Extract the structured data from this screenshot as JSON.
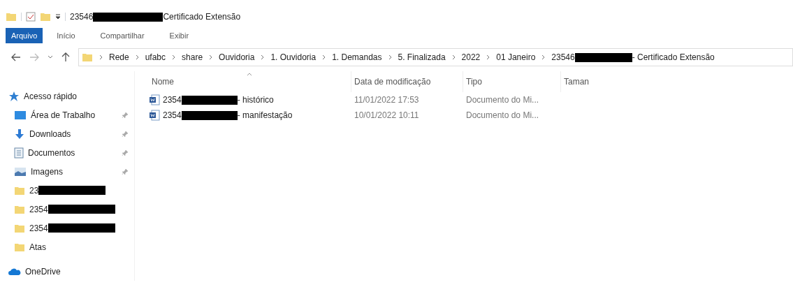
{
  "window": {
    "title": {
      "start": "23546",
      "redacted": true,
      "end": "Certificado Extensão"
    }
  },
  "ribbon_tabs": [
    {
      "label": "Arquivo",
      "selected": true
    },
    {
      "label": "Início",
      "selected": false
    },
    {
      "label": "Compartilhar",
      "selected": false
    },
    {
      "label": "Exibir",
      "selected": false
    }
  ],
  "address_bar": {
    "crumbs": [
      {
        "start": "Rede",
        "redacted": false
      },
      {
        "start": "ufabc",
        "redacted": false
      },
      {
        "start": "share",
        "redacted": false
      },
      {
        "start": "Ouvidoria",
        "redacted": false
      },
      {
        "start": "1. Ouvidoria",
        "redacted": false
      },
      {
        "start": "1. Demandas",
        "redacted": false
      },
      {
        "start": "5. Finalizada",
        "redacted": false
      },
      {
        "start": "2022",
        "redacted": false
      },
      {
        "start": "01 Janeiro",
        "redacted": false
      },
      {
        "start": "23546",
        "redacted": true,
        "end": "- Certificado Extensão"
      }
    ]
  },
  "sidebar": {
    "items": [
      {
        "kind": "quick",
        "label": "Acesso rápido",
        "pinned": false,
        "redacted": false
      },
      {
        "kind": "desktop",
        "label": "Área de Trabalho",
        "pinned": true,
        "redacted": false
      },
      {
        "kind": "downloads",
        "label": "Downloads",
        "pinned": true,
        "redacted": false
      },
      {
        "kind": "documents",
        "label": "Documentos",
        "pinned": true,
        "redacted": false
      },
      {
        "kind": "images",
        "label": "Imagens",
        "pinned": true,
        "redacted": false
      },
      {
        "kind": "folder",
        "label": "23",
        "pinned": false,
        "redacted": true
      },
      {
        "kind": "folder",
        "label": "2354",
        "pinned": false,
        "redacted": true
      },
      {
        "kind": "folder",
        "label": "2354",
        "pinned": false,
        "redacted": true
      },
      {
        "kind": "folder",
        "label": "Atas",
        "pinned": false,
        "redacted": false
      },
      {
        "kind": "cloud",
        "label": "OneDrive",
        "pinned": false,
        "redacted": false
      }
    ]
  },
  "table": {
    "columns": [
      "Nome",
      "Data de modificação",
      "Tipo",
      "Taman"
    ],
    "rows": [
      {
        "name_start": "2354",
        "redacted": true,
        "name_end": "- histórico",
        "date": "11/01/2022 17:53",
        "type": "Documento do Mi..."
      },
      {
        "name_start": "2354",
        "redacted": true,
        "name_end": "- manifestação",
        "date": "10/01/2022 10:11",
        "type": "Documento do Mi..."
      }
    ]
  }
}
